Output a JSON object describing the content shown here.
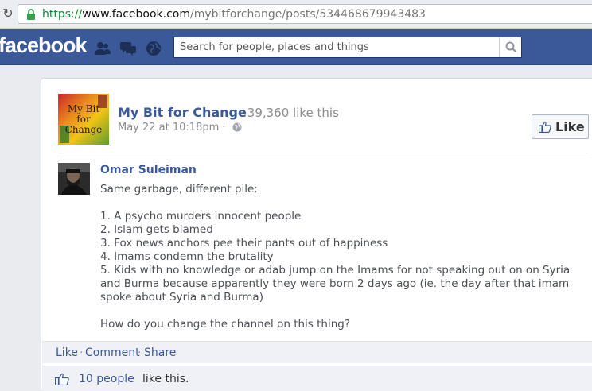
{
  "browser": {
    "url_scheme": "https://",
    "url_host": "www.facebook.com",
    "url_path": "/mybitforchange/posts/534468679943483"
  },
  "header": {
    "logo": "facebook",
    "search_placeholder": "Search for people, places and things",
    "brand_color": "#3b5998"
  },
  "post": {
    "page_name": "My Bit for Change",
    "page_logo_text": "My Bit for Change",
    "likes_count": "39,360 like this",
    "separator": "·",
    "date": "May 22 at 10:18pm ·",
    "like_button": "Like",
    "comment": {
      "author": "Omar Suleiman",
      "lines": [
        "Same garbage, different pile:",
        "",
        "1. A psycho murders innocent people",
        "2. Islam gets blamed",
        "3. Fox news anchors pee their pants out of happiness",
        "4. Imams condemn the brutality",
        "5. Kids with no knowledge or adab jump on the Imams for not speaking out on on Syria and Burma because apparently they were born 2 days ago (ie. the day after that imam spoke about Syria and Burma)",
        "",
        "How do you change the channel on this thing?"
      ]
    },
    "actions": {
      "like": "Like",
      "comment": "Comment",
      "share": "Share",
      "dot": "·"
    },
    "likes_summary": {
      "people": "10 people",
      "rest": "like this."
    }
  }
}
